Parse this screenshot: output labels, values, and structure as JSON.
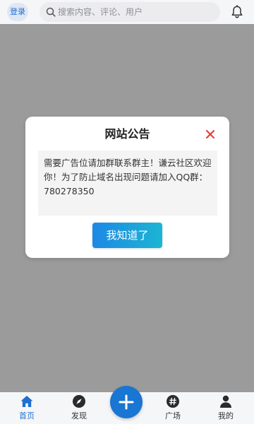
{
  "header": {
    "login_label": "登录",
    "search_placeholder": "搜索内容、评论、用户"
  },
  "dialog": {
    "title": "网站公告",
    "message": "需要广告位请加群联系群主！谦云社区欢迎你！为了防止域名出现问题请加入QQ群：780278350",
    "confirm_label": "我知道了"
  },
  "bottom_nav": {
    "items": [
      {
        "label": "首页",
        "icon": "home-icon",
        "active": true
      },
      {
        "label": "发现",
        "icon": "compass-icon",
        "active": false
      },
      {
        "label": "广场",
        "icon": "hashtag-icon",
        "active": false
      },
      {
        "label": "我的",
        "icon": "user-icon",
        "active": false
      }
    ],
    "center_action_icon": "plus-icon"
  },
  "colors": {
    "accent": "#1f6fd1",
    "fab": "#1976d2",
    "close": "#e53935",
    "overlay": "#9b9b9b"
  }
}
